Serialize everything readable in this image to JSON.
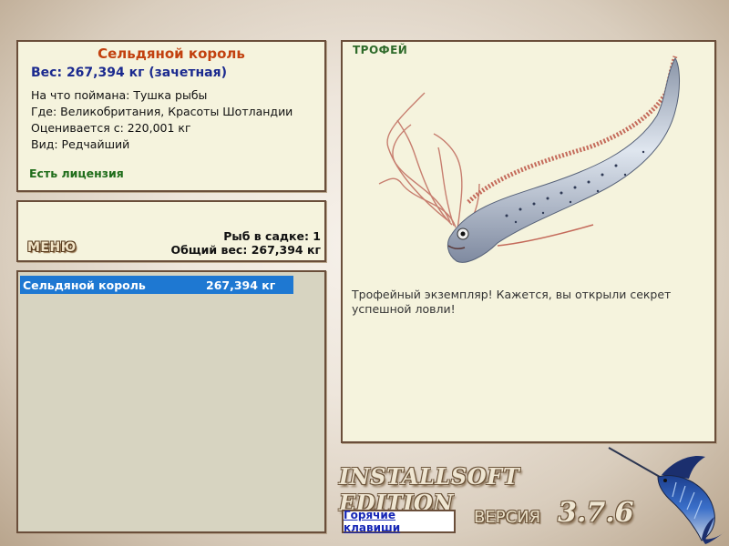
{
  "fish": {
    "name": "Сельдяной король",
    "weight_line": "Вес: 267,394 кг (зачетная)",
    "bait_line": "На что поймана: Тушка рыбы",
    "location_line": "Где: Великобритания, Красоты Шотландии",
    "valued_line": "Оценивается с: 220,001 кг",
    "rarity_line": "Вид: Редчайший",
    "license": "Есть лицензия"
  },
  "menu": {
    "label": "МЕНЮ"
  },
  "keepnet": {
    "count_line": "Рыб в садке: 1",
    "total_line": "Общий вес: 267,394 кг"
  },
  "catch_list": {
    "items": [
      {
        "name": "Сельдяной король",
        "weight": "267,394 кг"
      }
    ]
  },
  "trophy": {
    "label": "ТРОФЕЙ",
    "description": "Трофейный экземпляр! Кажется, вы открыли секрет успешной ловли!"
  },
  "footer": {
    "brand": "INSTALLSOFT EDITION",
    "version_label": "ВЕРСИЯ",
    "version_number": "3.7.6",
    "hotkeys": "Горячие клавиши"
  },
  "colors": {
    "panel_bg": "#f5f3dd",
    "panel_border": "#6a4e3a",
    "list_bg": "#d7d4c1",
    "selected_row": "#1e78d2",
    "fish_name": "#c2410f",
    "weight_text": "#1b2a8f",
    "license_text": "#1f6d1a",
    "trophy_label": "#2f6b2a",
    "link_text": "#1626b5"
  },
  "icons": {
    "fish_image": "oarfish-image",
    "logo": "marlin-logo"
  }
}
